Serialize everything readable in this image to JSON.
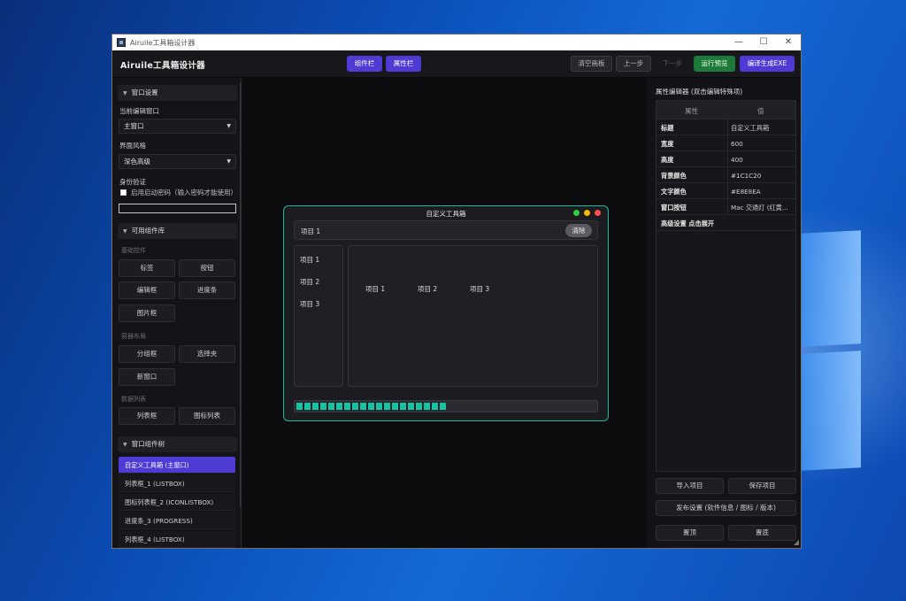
{
  "window": {
    "title": "Airuile工具箱设计器",
    "controls": {
      "minimize": "—",
      "maximize": "☐",
      "close": "✕"
    }
  },
  "toolbar": {
    "app_name": "Airuile工具箱设计器",
    "components_tab": "组件栏",
    "properties_tab": "属性栏",
    "clear_canvas": "清空画板",
    "undo": "上一步",
    "redo": "下一步",
    "run_preview": "运行预览",
    "build_exe": "编译生成EXE"
  },
  "left": {
    "window_settings": {
      "header": "窗口设置",
      "current_window_label": "当前编辑窗口",
      "current_window_value": "主窗口",
      "theme_label": "界面风格",
      "theme_value": "深色高级",
      "auth_label": "身份验证",
      "auth_checkbox_label": "启用启动密码（输入密码才能使用）",
      "password_value": ""
    },
    "components": {
      "header": "可用组件库",
      "basic_group": "基础控件",
      "label": "标签",
      "button": "按钮",
      "editbox": "编辑框",
      "progressbar": "进度条",
      "imagebox": "图片框",
      "container_group": "容器布局",
      "groupbox": "分组框",
      "tabs": "选择夹",
      "new_window": "新窗口",
      "data_group": "数据列表",
      "listbox": "列表框",
      "iconlist": "图标列表"
    },
    "tree": {
      "header": "窗口组件树",
      "items": [
        "自定义工具箱 (主窗口)",
        "列表框_1 (LISTBOX)",
        "图标列表框_2 (ICONLISTBOX)",
        "进度条_3 (PROGRESS)",
        "列表框_4 (LISTBOX)"
      ]
    }
  },
  "preview": {
    "title": "自定义工具箱",
    "input_text": "项目 1",
    "clear_button": "清除",
    "list_items": [
      "项目 1",
      "项目 2",
      "项目 3"
    ],
    "icon_items": [
      "项目 1",
      "项目 2",
      "项目 3"
    ],
    "progress_fraction": 0.5,
    "colors": {
      "border": "#1fb89a",
      "dot_green": "#2ecc40",
      "dot_yellow": "#f5b800",
      "dot_red": "#ff4d4d",
      "progress": "#15c2a2"
    }
  },
  "right": {
    "title": "属性编辑器 (双击编辑特殊项)",
    "col_property": "属性",
    "col_value": "值",
    "rows": [
      {
        "k": "标题",
        "v": "自定义工具箱"
      },
      {
        "k": "宽度",
        "v": "600"
      },
      {
        "k": "高度",
        "v": "400"
      },
      {
        "k": "背景颜色",
        "v": "#1C1C20"
      },
      {
        "k": "文字颜色",
        "v": "#E8E8EA"
      },
      {
        "k": "窗口按钮",
        "v": "Mac 交通灯 (红黄..."
      }
    ],
    "advanced": "高级设置  点击展开",
    "import_project": "导入项目",
    "save_project": "保存项目",
    "publish_settings": "发布设置 (软件信息 / 图标 / 版本)",
    "bring_top": "置顶",
    "send_bottom": "置底"
  }
}
